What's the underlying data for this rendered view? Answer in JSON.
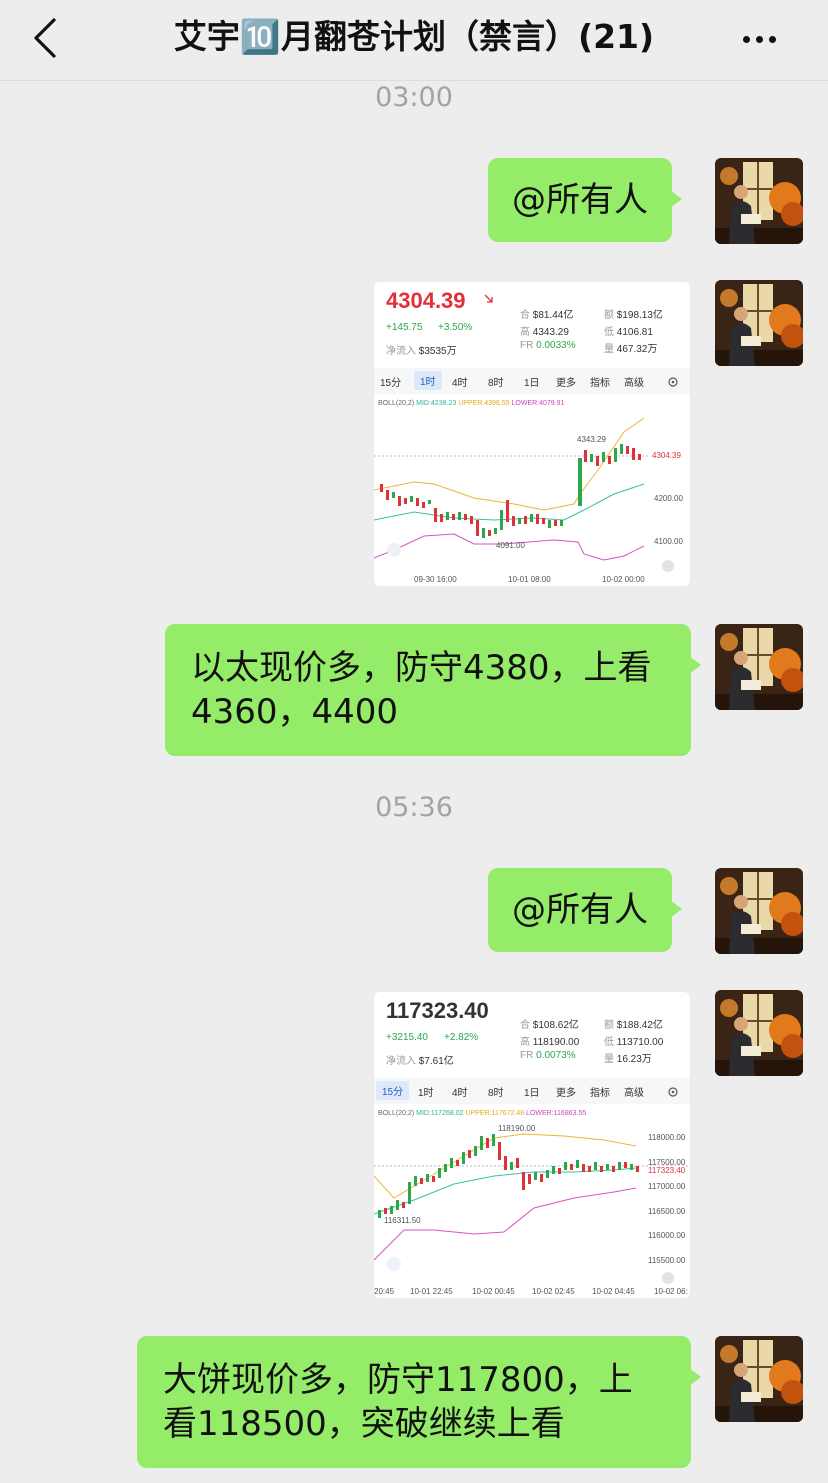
{
  "header": {
    "title": "艾宇🔟月翻苍计划（禁言）(21)"
  },
  "messages": {
    "t1": "03:00",
    "m1": "@所有人",
    "m2": "以太现价多，防守4380，上看4360，4400",
    "t2": "05:36",
    "m3": "@所有人",
    "m4": "大饼现价多，防守117800，上看118500，突破继续上看"
  },
  "eth_card": {
    "price": "4304.39",
    "change": "+145.75",
    "change_pct": "+3.50%",
    "inflow_label": "净流入",
    "inflow": "$3535万",
    "he_label": "合",
    "he": "$81.44亿",
    "e_label": "额",
    "e": "$198.13亿",
    "high_label": "高",
    "high": "4343.29",
    "low_label": "低",
    "low": "4106.81",
    "fr_label": "FR",
    "fr": "0.0033%",
    "vol_label": "量",
    "vol": "467.32万",
    "tabs": [
      "15分",
      "1时",
      "4时",
      "8时",
      "1日",
      "更多",
      "指标",
      "高级"
    ],
    "boll": "BOLL(20,2)",
    "mid": "MID:4238.23",
    "upper": "UPPER:4396.55",
    "lower": "LOWER:4079.91",
    "hi_mark": "4343.29",
    "lo_mark": "4091.00",
    "cur_mark": "4304.39",
    "y_ticks": [
      "4200.00",
      "4100.00"
    ],
    "x_ticks": [
      "09-30 16:00",
      "10-01 08:00",
      "10-02 00:00"
    ]
  },
  "btc_card": {
    "price": "117323.40",
    "change": "+3215.40",
    "change_pct": "+2.82%",
    "inflow_label": "净流入",
    "inflow": "$7.61亿",
    "he_label": "合",
    "he": "$108.62亿",
    "e_label": "额",
    "e": "$188.42亿",
    "high_label": "高",
    "high": "118190.00",
    "low_label": "低",
    "low": "113710.00",
    "fr_label": "FR",
    "fr": "0.0073%",
    "vol_label": "量",
    "vol": "16.23万",
    "tabs": [
      "15分",
      "1时",
      "4时",
      "8时",
      "1日",
      "更多",
      "指标",
      "高级"
    ],
    "boll": "BOLL(20,2)",
    "mid": "MID:117268.02",
    "upper": "UPPER:117672.48",
    "lower": "LOWER:116863.55",
    "hi_mark": "118190.00",
    "lo_mark": "116311.50",
    "cur_mark": "117323.40",
    "y_ticks": [
      "118000.00",
      "117500.00",
      "117000.00",
      "116500.00",
      "116000.00",
      "115500.00"
    ],
    "x_ticks": [
      "20:45",
      "10-01 22:45",
      "10-02 00:45",
      "10-02 02:45",
      "10-02 04:45",
      "10-02 06:"
    ]
  }
}
